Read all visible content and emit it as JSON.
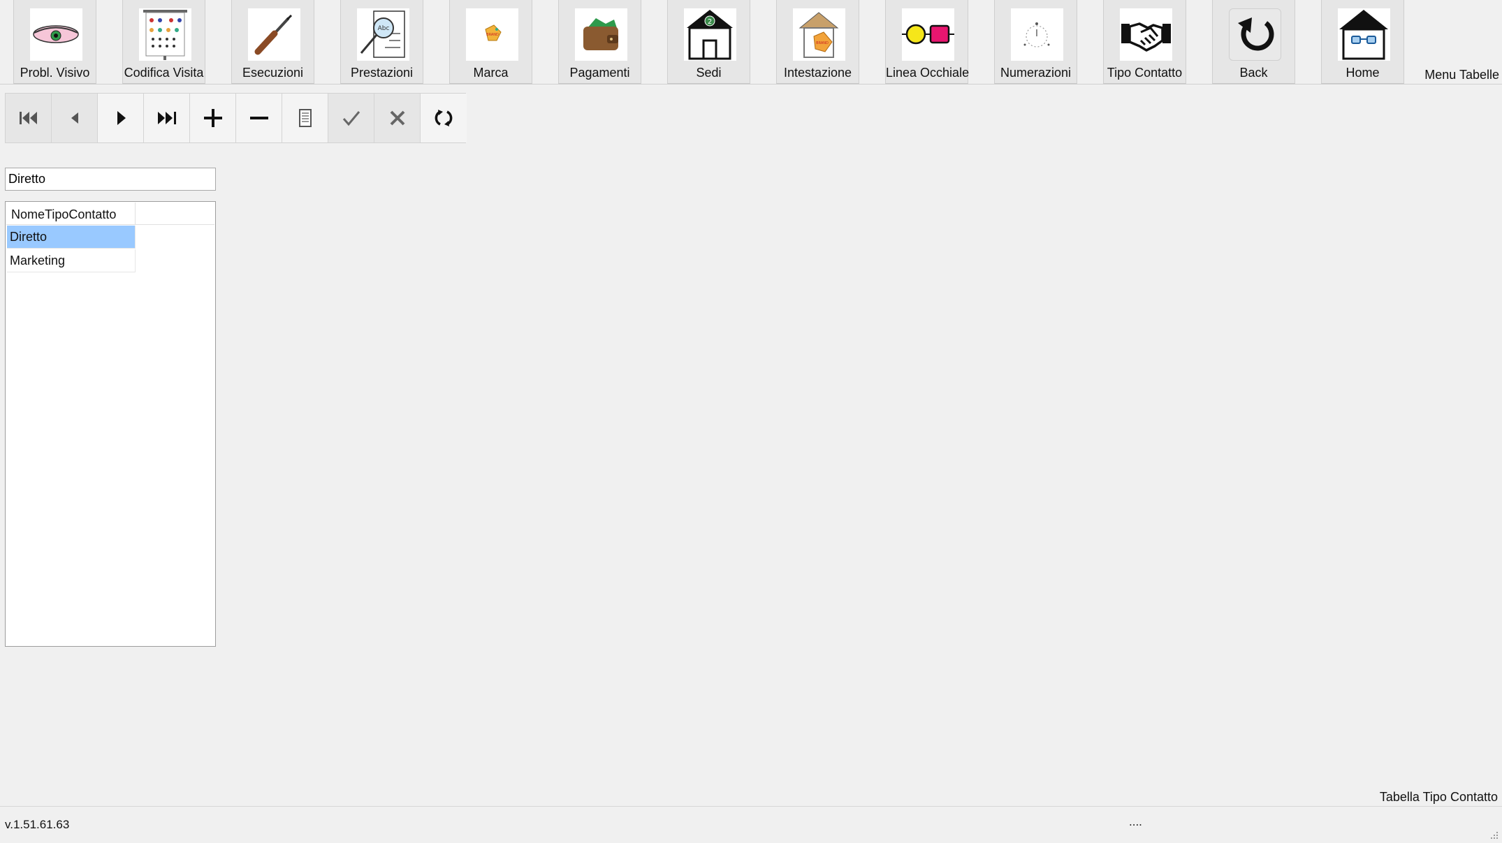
{
  "ribbon": {
    "items": [
      {
        "label": "Probl. Visivo",
        "icon": "eye-icon"
      },
      {
        "label": "Codifica Visita",
        "icon": "eye-chart-icon"
      },
      {
        "label": "Esecuzioni",
        "icon": "screwdriver-icon"
      },
      {
        "label": "Prestazioni",
        "icon": "magnifier-document-icon"
      },
      {
        "label": "Marca",
        "icon": "brand-tag-icon"
      },
      {
        "label": "Pagamenti",
        "icon": "wallet-icon"
      },
      {
        "label": "Sedi",
        "icon": "house-number-icon"
      },
      {
        "label": "Intestazione",
        "icon": "house-tag-icon"
      },
      {
        "label": "Linea Occhiale",
        "icon": "glasses-line-icon"
      },
      {
        "label": "Numerazioni",
        "icon": "numbering-icon"
      },
      {
        "label": "Tipo Contatto",
        "icon": "handshake-icon"
      },
      {
        "label": "Back",
        "icon": "back-arrow-icon"
      },
      {
        "label": "Home",
        "icon": "home-icon"
      }
    ],
    "menu_title": "Menu Tabelle"
  },
  "navigator": {
    "buttons": [
      "first-record-icon",
      "previous-record-icon",
      "next-record-icon",
      "last-record-icon",
      "add-record-icon",
      "delete-record-icon",
      "edit-record-icon",
      "confirm-icon",
      "cancel-icon",
      "refresh-icon"
    ]
  },
  "filter": {
    "value": "Diretto"
  },
  "grid": {
    "header": "NomeTipoContatto",
    "rows": [
      "Diretto",
      "Marketing"
    ],
    "selected_index": 0
  },
  "caption": "Tabella Tipo Contatto",
  "status": {
    "version": "v.1.51.61.63",
    "indicator": "...."
  },
  "colors": {
    "selection": "#99c9ff",
    "background": "#f0f0f0"
  }
}
